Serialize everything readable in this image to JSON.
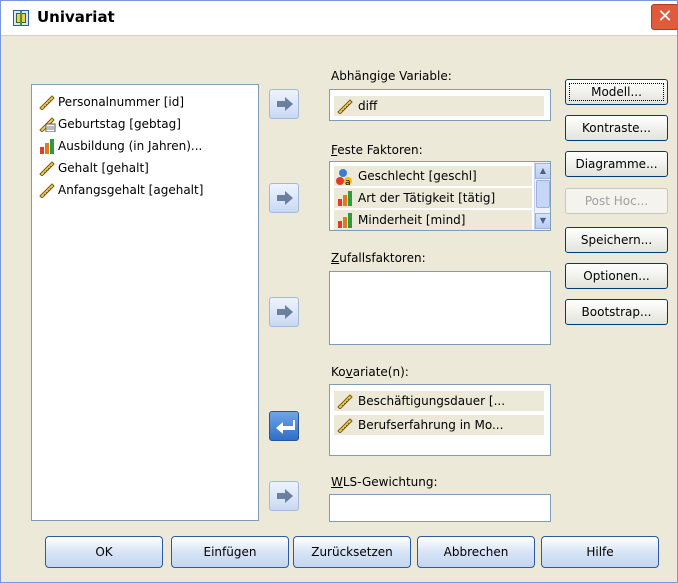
{
  "window": {
    "title": "Univariat",
    "close_glyph": "✕"
  },
  "source_list": {
    "items": [
      {
        "label": "Personalnummer [id]",
        "icon": "ruler-scale-icon"
      },
      {
        "label": "Geburtstag [gebtag]",
        "icon": "date-scale-icon"
      },
      {
        "label": "Ausbildung (in Jahren)...",
        "icon": "bar-ordinal-icon"
      },
      {
        "label": "Gehalt [gehalt]",
        "icon": "ruler-scale-icon"
      },
      {
        "label": "Anfangsgehalt [agehalt]",
        "icon": "ruler-scale-icon"
      }
    ]
  },
  "targets": {
    "dependent": {
      "label_pre": "Abhängige Variable:",
      "value": "diff"
    },
    "fixed": {
      "label_pre": "",
      "label_key": "F",
      "label_post": "este Faktoren:",
      "items": [
        {
          "label": "Geschlecht [geschl]",
          "icon": "nominal-icon"
        },
        {
          "label": "Art der Tätigkeit [tätig]",
          "icon": "bar-ordinal-icon"
        },
        {
          "label": "Minderheit [mind]",
          "icon": "bar-ordinal-icon"
        }
      ]
    },
    "random": {
      "label_pre": "",
      "label_key": "Z",
      "label_post": "ufallsfaktoren:"
    },
    "covariates": {
      "label_pre": "Ko",
      "label_key": "v",
      "label_post": "ariate(n):",
      "items": [
        {
          "label": "Beschäftigungsdauer [...",
          "icon": "ruler-scale-icon"
        },
        {
          "label": "Berufserfahrung in Mo...",
          "icon": "ruler-scale-icon"
        }
      ]
    },
    "wls": {
      "label_pre": "",
      "label_key": "W",
      "label_post": "LS-Gewichtung:",
      "value": ""
    }
  },
  "side_buttons": [
    {
      "label": "Modell...",
      "key": "",
      "enabled": true
    },
    {
      "label": "Kontraste...",
      "enabled": true
    },
    {
      "label": "Diagramme...",
      "enabled": true
    },
    {
      "label": "Post Hoc...",
      "enabled": false
    },
    {
      "label": "Speichern...",
      "enabled": true
    },
    {
      "label": "Optionen...",
      "enabled": true
    },
    {
      "label": "Bootstrap...",
      "enabled": true
    }
  ],
  "bottom_buttons": [
    {
      "label": "OK"
    },
    {
      "label": "Einfügen"
    },
    {
      "label": "Zurücksetzen"
    },
    {
      "label": "Abbrechen"
    },
    {
      "label": "Hilfe"
    }
  ],
  "colors": {
    "button_border": "#2b5aa7",
    "selection_bg": "#ece9d8",
    "panel_border": "#7f9db9",
    "arrow_active": "#2f6fc8"
  }
}
